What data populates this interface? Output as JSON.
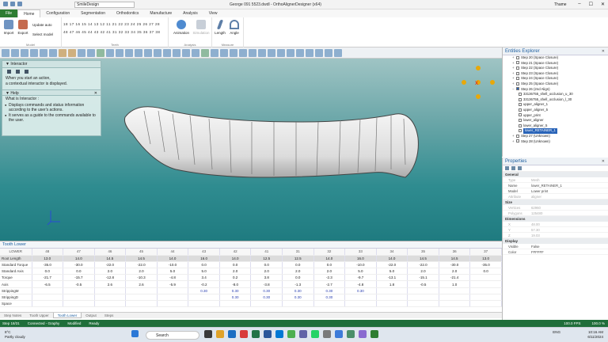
{
  "window": {
    "title": "George 091 5523.dwdl - OrthoAlignerDesigner (x64)",
    "combo_value": "SmileDesign",
    "user": "Thame"
  },
  "ribbon_tabs": [
    "File",
    "Home",
    "Configuration",
    "Segmentation",
    "Orthodontics",
    "Manufacture",
    "Analysis",
    "View"
  ],
  "ribbon": {
    "import_label": "Import",
    "export_label": "Export",
    "model_group": "Model",
    "update_auto": "Update auto",
    "select_model": "Select model",
    "teeth_upper": "18 17 16 15 14 13 12 11 21 22 23 24 25 26 27 28",
    "teeth_lower": "48 47 46 45 44 43 42 41 31 32 33 34 35 36 37 38",
    "teeth_group": "Teeth",
    "animation_label": "Animation",
    "simulation_label": "Simulation",
    "analysis_group": "Analysis",
    "length_label": "Length",
    "angle_label": "Angle",
    "measure_group": "Measure"
  },
  "interactor": {
    "title": "Interactor",
    "line1": "When you start an action,",
    "line2": "a contextual interactor is displayed.",
    "help_title": "Help",
    "help_close": "✕",
    "help_heading": "What is Interactor :",
    "bullet1": "Displays commands and status information according to the user's actions.",
    "bullet2": "It serves as a guide to the commands available to the user."
  },
  "table": {
    "title": "Tooth Lower",
    "headers": [
      "LOWER",
      "48",
      "47",
      "46",
      "45",
      "44",
      "43",
      "42",
      "41",
      "31",
      "32",
      "33",
      "34",
      "35",
      "36",
      "37"
    ],
    "rows": [
      {
        "label": "Root Length",
        "values": [
          "",
          "13.0",
          "14.0",
          "14.5",
          "14.5",
          "14.0",
          "16.0",
          "14.0",
          "12.5",
          "12.5",
          "14.0",
          "16.0",
          "14.0",
          "14.5",
          "14.5",
          "13.0"
        ],
        "selected": true
      },
      {
        "label": "Standard Torque",
        "values": [
          "",
          "-35.0",
          "-30.0",
          "-22.0",
          "-22.0",
          "-10.0",
          "0.0",
          "0.0",
          "0.0",
          "0.0",
          "0.0",
          "-10.0",
          "-22.0",
          "-22.0",
          "-30.0",
          "-35.0"
        ]
      },
      {
        "label": "Standard Axis",
        "values": [
          "",
          "0.0",
          "0.0",
          "2.0",
          "2.0",
          "5.0",
          "5.0",
          "2.0",
          "2.0",
          "2.0",
          "2.0",
          "5.0",
          "5.0",
          "2.0",
          "2.0",
          "0.0"
        ]
      },
      {
        "label": "Torque",
        "values": [
          "",
          "-21.7",
          "-15.7",
          "-12.8",
          "-10.3",
          "-4.8",
          "3.4",
          "0.2",
          "3.8",
          "0.0",
          "-2.3",
          "-9.7",
          "-13.1",
          "-15.1",
          "-21.4",
          ""
        ]
      },
      {
        "label": "Axis",
        "values": [
          "",
          "-6.5",
          "-0.5",
          "2.6",
          "2.6",
          "-5.9",
          "-0.2",
          "-8.0",
          "-3.8",
          "-1.3",
          "-2.7",
          "-4.8",
          "1.8",
          "-0.5",
          "1.0",
          ""
        ]
      },
      {
        "label": "StrippingM",
        "values": [
          "",
          "",
          "",
          "",
          "",
          "",
          "0.30",
          "0.30",
          "0.30",
          "0.30",
          "0.30",
          "0.30",
          "",
          "",
          "",
          ""
        ],
        "blue": true
      },
      {
        "label": "StrippingD",
        "values": [
          "",
          "",
          "",
          "",
          "",
          "",
          "",
          "0.30",
          "0.30",
          "0.30",
          "0.30",
          "",
          "",
          "",
          "",
          ""
        ],
        "blue": true
      },
      {
        "label": "Space",
        "values": [
          "",
          "",
          "",
          "",
          "",
          "",
          "",
          "",
          "",
          "",
          "",
          "",
          "",
          "",
          "",
          ""
        ]
      }
    ]
  },
  "bottom_tabs": [
    "Step Notes",
    "Tooth Upper",
    "Tooth Lower",
    "Output",
    "Steps"
  ],
  "status": {
    "step": "Step 18/31",
    "connected": "Connected - Graphy",
    "modified": "Modified",
    "ready": "Ready",
    "fps": "100.0 FPS",
    "zoom": "100.0 %"
  },
  "entities": {
    "title": "Entities Explorer",
    "items": [
      "Step 20 (Space Closure)",
      "Step 21 (Space Closure)",
      "Step 22 (Space Closure)",
      "Step 23 (Space Closure)",
      "Step 24 (Space Closure)",
      "Step 25 (Space Closure)",
      "Step 26 (2nd Align)"
    ],
    "children": [
      "33136755_shell_occlusion_u_30",
      "33136755_shell_occlusion_l_30",
      "upper_aligner_1",
      "upper_aligner_5",
      "upper_print",
      "lower_aligner",
      "lower_aligner_5"
    ],
    "selected": "lower_RETAINER_1",
    "after": [
      "Step 27 (Unknown)",
      "Step 28 (Unknown)"
    ]
  },
  "properties": {
    "title": "Properties",
    "general": "General",
    "rows_general": [
      {
        "k": "Type",
        "v": "Mesh",
        "dim": true
      },
      {
        "k": "Name",
        "v": "lower_RETAINER_1",
        "dim": false
      },
      {
        "k": "Model",
        "v": "Lower print",
        "dim": false
      },
      {
        "k": "Attribute",
        "v": "aligner",
        "dim": true
      }
    ],
    "size": "Size",
    "rows_size": [
      {
        "k": "Vertices",
        "v": "62960",
        "dim": true
      },
      {
        "k": "Polygons",
        "v": "125480",
        "dim": true
      }
    ],
    "dimensions": "Dimensions",
    "rows_dim": [
      {
        "k": "X",
        "v": "48.00",
        "dim": true
      },
      {
        "k": "Y",
        "v": "57.30",
        "dim": true
      },
      {
        "k": "Z",
        "v": "19.03",
        "dim": true
      }
    ],
    "display": "Display",
    "rows_display": [
      {
        "k": "Visible",
        "v": "False",
        "dim": false
      },
      {
        "k": "Color",
        "v": "FFFFFF",
        "dim": false
      }
    ]
  },
  "taskbar": {
    "weather_temp": "8°C",
    "weather_desc": "Partly cloudy",
    "search_placeholder": "Search",
    "lang": "ENG",
    "time": "10:16 AM",
    "date": "6/11/2024"
  }
}
